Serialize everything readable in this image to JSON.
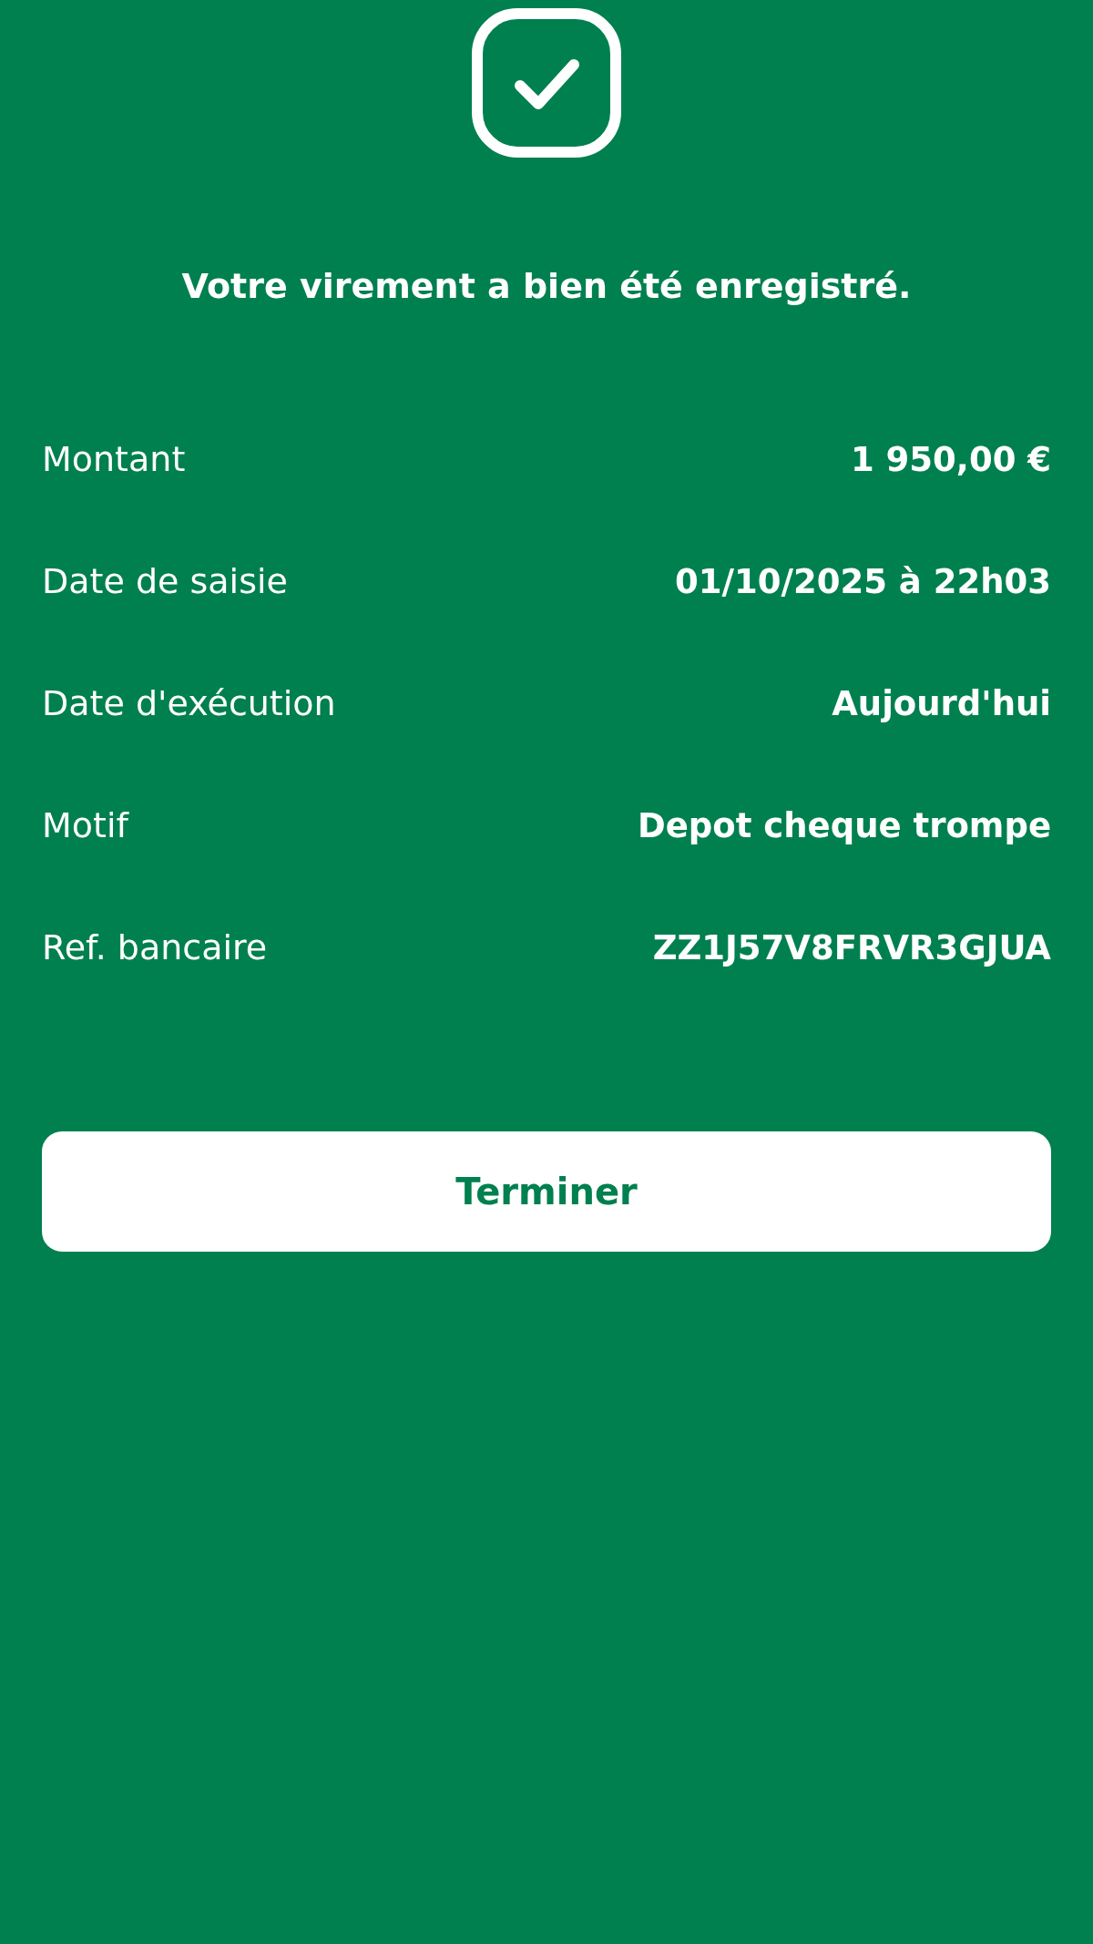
{
  "confirmation": {
    "title": "Votre virement a bien été enregistré."
  },
  "details": [
    {
      "label": "Montant",
      "value": "1 950,00 €"
    },
    {
      "label": "Date de saisie",
      "value": "01/10/2025 à 22h03"
    },
    {
      "label": "Date d'exécution",
      "value": "Aujourd'hui"
    },
    {
      "label": "Motif",
      "value": "Depot cheque trompe"
    },
    {
      "label": "Ref. bancaire",
      "value": "ZZ1J57V8FRVR3GJUA"
    }
  ],
  "button": {
    "label": "Terminer"
  }
}
